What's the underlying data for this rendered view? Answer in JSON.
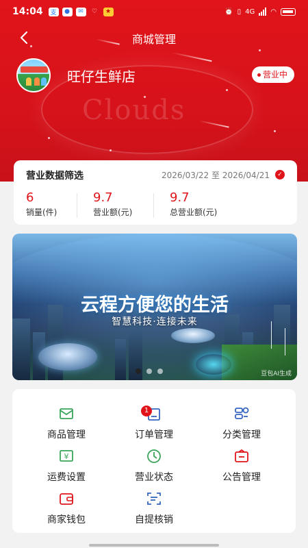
{
  "status_bar": {
    "time": "14:04",
    "app_icons": [
      "alipay-icon",
      "baidu-icon",
      "mail-icon",
      "taobao-icon",
      "game-icon"
    ],
    "network": "4G"
  },
  "nav": {
    "title": "商城管理"
  },
  "store": {
    "name": "旺仔生鲜店",
    "status_badge": "营业中"
  },
  "stats": {
    "title": "营业数据筛选",
    "range": "2026/03/22 至 2026/04/21",
    "items": [
      {
        "value": "6",
        "label": "销量(件)"
      },
      {
        "value": "9.7",
        "label": "营业额(元)"
      },
      {
        "value": "9.7",
        "label": "总营业额(元)"
      }
    ]
  },
  "banner": {
    "title": "云程方便您的生活",
    "subtitle": "智慧科技·连接未来",
    "ai_tag": "豆包AI生成",
    "slide_count": 3,
    "active_slide": 0
  },
  "menu": {
    "items": [
      {
        "label": "商品管理",
        "icon": "product-box-icon",
        "color": "#3aa55a"
      },
      {
        "label": "订单管理",
        "icon": "order-clipboard-icon",
        "color": "#3566c2",
        "badge": "1"
      },
      {
        "label": "分类管理",
        "icon": "category-icon",
        "color": "#3566c2"
      },
      {
        "label": "运费设置",
        "icon": "yuan-fee-icon",
        "color": "#3aa55a"
      },
      {
        "label": "营业状态",
        "icon": "clock-icon",
        "color": "#3aa55a"
      },
      {
        "label": "公告管理",
        "icon": "notice-icon",
        "color": "#e0141a"
      },
      {
        "label": "商家钱包",
        "icon": "wallet-icon",
        "color": "#e0141a"
      },
      {
        "label": "自提核销",
        "icon": "scan-icon",
        "color": "#3566c2"
      }
    ]
  },
  "colors": {
    "primary": "#e0141a",
    "background": "#f2f2f2",
    "card": "#ffffff"
  },
  "hero_watermark": "Clouds"
}
